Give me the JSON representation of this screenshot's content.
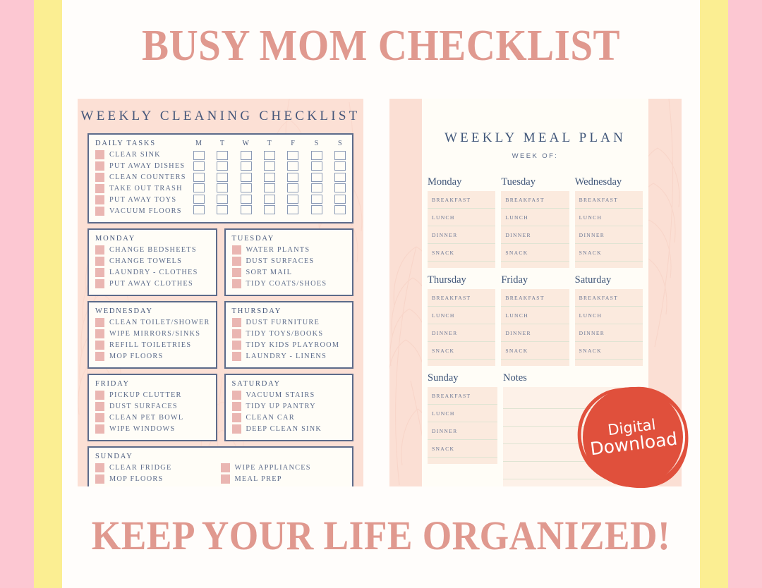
{
  "colors": {
    "stripe_pink": "#fcc7d2",
    "stripe_yellow": "#fbee92",
    "headline_pink": "#e0998f",
    "slate_blue": "#46577a",
    "swatch_pink": "#eab6b2",
    "panel_peach": "#fce0d5",
    "meal_cell_peach": "#fbeade",
    "badge_red": "#e0503c"
  },
  "headline": "BUSY MOM CHECKLIST",
  "tagline": "KEEP YOUR LIFE ORGANIZED!",
  "cleaning": {
    "title": "WEEKLY CLEANING CHECKLIST",
    "daily": {
      "heading": "DAILY TASKS",
      "day_initials": [
        "M",
        "T",
        "W",
        "T",
        "F",
        "S",
        "S"
      ],
      "tasks": [
        "CLEAR SINK",
        "PUT AWAY DISHES",
        "CLEAN COUNTERS",
        "TAKE OUT TRASH",
        "PUT AWAY TOYS",
        "VACUUM FLOORS"
      ]
    },
    "days": [
      {
        "heading": "MONDAY",
        "tasks": [
          "CHANGE BEDSHEETS",
          "CHANGE TOWELS",
          "LAUNDRY - CLOTHES",
          "PUT AWAY CLOTHES"
        ]
      },
      {
        "heading": "TUESDAY",
        "tasks": [
          "WATER PLANTS",
          "DUST SURFACES",
          "SORT MAIL",
          "TIDY COATS/SHOES"
        ]
      },
      {
        "heading": "WEDNESDAY",
        "tasks": [
          "CLEAN TOILET/SHOWER",
          "WIPE MIRRORS/SINKS",
          "REFILL TOILETRIES",
          "MOP FLOORS"
        ]
      },
      {
        "heading": "THURSDAY",
        "tasks": [
          "DUST FURNITURE",
          "TIDY TOYS/BOOKS",
          "TIDY KIDS PLAYROOM",
          "LAUNDRY - LINENS"
        ]
      },
      {
        "heading": "FRIDAY",
        "tasks": [
          "PICKUP CLUTTER",
          "DUST SURFACES",
          "CLEAN PET BOWL",
          "WIPE WINDOWS"
        ]
      },
      {
        "heading": "SATURDAY",
        "tasks": [
          "VACUUM STAIRS",
          "TIDY UP PANTRY",
          "CLEAN CAR",
          "DEEP CLEAN SINK"
        ]
      }
    ],
    "sunday": {
      "heading": "SUNDAY",
      "tasks_col1": [
        "CLEAR FRIDGE",
        "MOP FLOORS"
      ],
      "tasks_col2": [
        "WIPE APPLIANCES",
        "MEAL PREP"
      ]
    }
  },
  "meal_plan": {
    "title": "WEEKLY MEAL PLAN",
    "subtitle": "WEEK OF:",
    "meals": [
      "BREAKFAST",
      "LUNCH",
      "DINNER",
      "SNACK"
    ],
    "rows": [
      [
        "Monday",
        "Tuesday",
        "Wednesday"
      ],
      [
        "Thursday",
        "Friday",
        "Saturday"
      ]
    ],
    "last_row": {
      "day": "Sunday",
      "notes_label": "Notes",
      "note_lines": 6
    }
  },
  "badge": {
    "line1": "Digital",
    "line2": "Download"
  }
}
